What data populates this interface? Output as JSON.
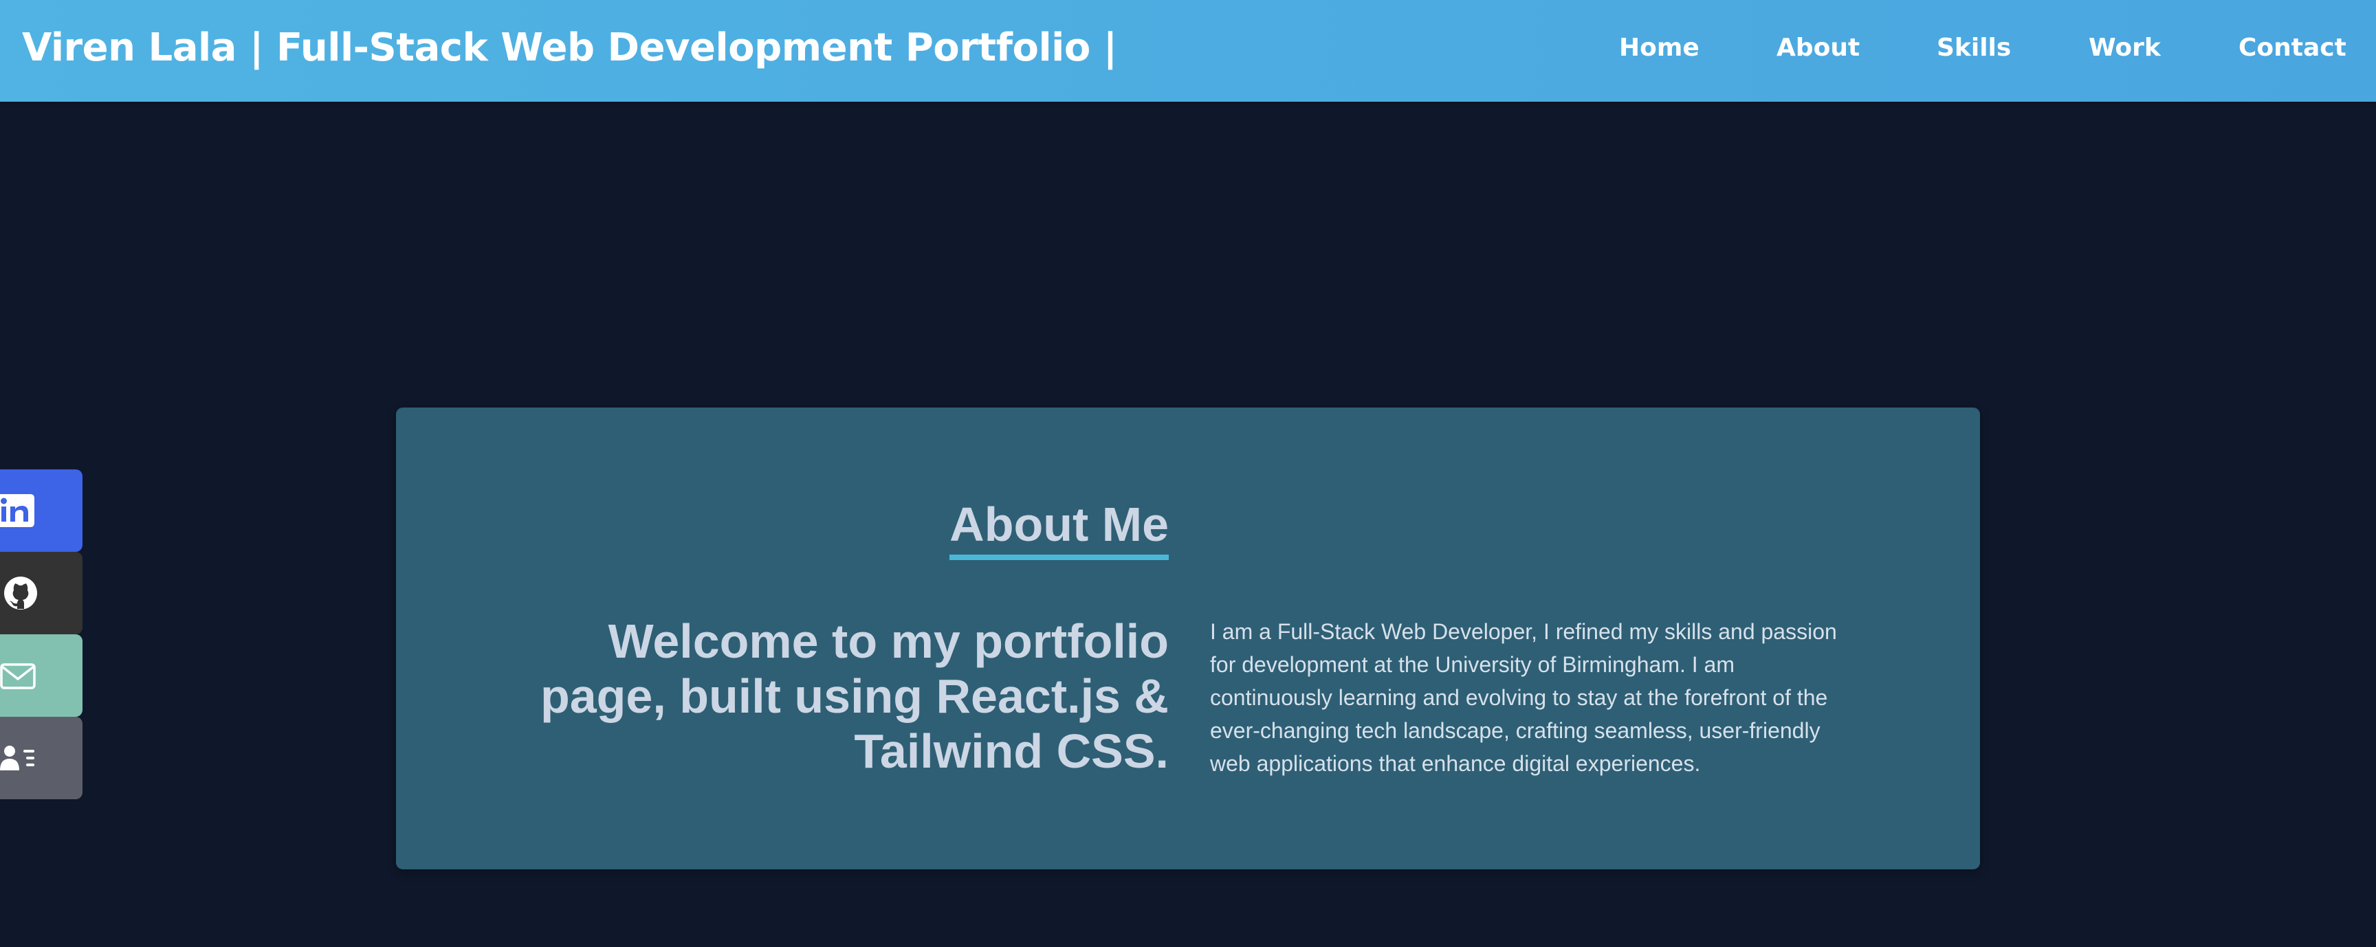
{
  "header": {
    "title": "Viren Lala | Full-Stack Web Development Portfolio |",
    "nav": [
      "Home",
      "About",
      "Skills",
      "Work",
      "Contact"
    ]
  },
  "social": [
    {
      "name": "LinkedIn",
      "icon": "linkedin-icon",
      "color": "#3d63e6"
    },
    {
      "name": "GitHub",
      "icon": "github-icon",
      "color": "#333333"
    },
    {
      "name": "Email",
      "icon": "mail-icon",
      "color": "#82c1b0"
    },
    {
      "name": "Resume",
      "icon": "contact-card-icon",
      "color": "#5c5f69"
    }
  ],
  "about": {
    "heading": "About Me",
    "welcome": "Welcome to my portfolio page, built using React.js & Tailwind CSS.",
    "bio": "I am a Full-Stack Web Developer, I refined my skills and passion for development at the University of Birmingham. I am continuously learning and evolving to stay at the forefront of the ever-changing tech landscape, crafting seamless, user-friendly web applications that enhance digital experiences."
  },
  "colors": {
    "background": "#0f172a",
    "header": "#4fb0e2",
    "card": "#2e5f75",
    "accent": "#4ab8d8",
    "text": "#ccd6e4"
  }
}
